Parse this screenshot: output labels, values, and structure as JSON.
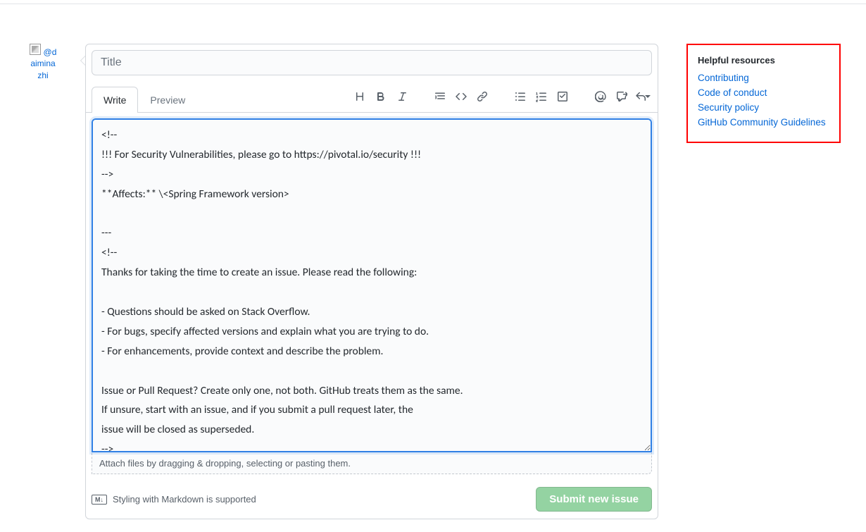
{
  "avatar": {
    "alt": "@daiminazhi"
  },
  "title": {
    "placeholder": "Title",
    "value": ""
  },
  "tabs": {
    "write": "Write",
    "preview": "Preview"
  },
  "body": "<!--\n!!! For Security Vulnerabilities, please go to https://pivotal.io/security !!!\n-->\n**Affects:** \\<Spring Framework version>\n\n---\n<!--\nThanks for taking the time to create an issue. Please read the following:\n\n- Questions should be asked on Stack Overflow.\n- For bugs, specify affected versions and explain what you are trying to do.\n- For enhancements, provide context and describe the problem.\n\nIssue or Pull Request? Create only one, not both. GitHub treats them as the same.\nIf unsure, start with an issue, and if you submit a pull request later, the\nissue will be closed as superseded.\n-->",
  "attach": "Attach files by dragging & dropping, selecting or pasting them.",
  "md_hint": "Styling with Markdown is supported",
  "md_badge": "M↓",
  "submit": "Submit new issue",
  "sidebar": {
    "title": "Helpful resources",
    "links": {
      "contributing": "Contributing",
      "code_of_conduct": "Code of conduct",
      "security_policy": "Security policy",
      "community_guidelines": "GitHub Community Guidelines"
    }
  }
}
